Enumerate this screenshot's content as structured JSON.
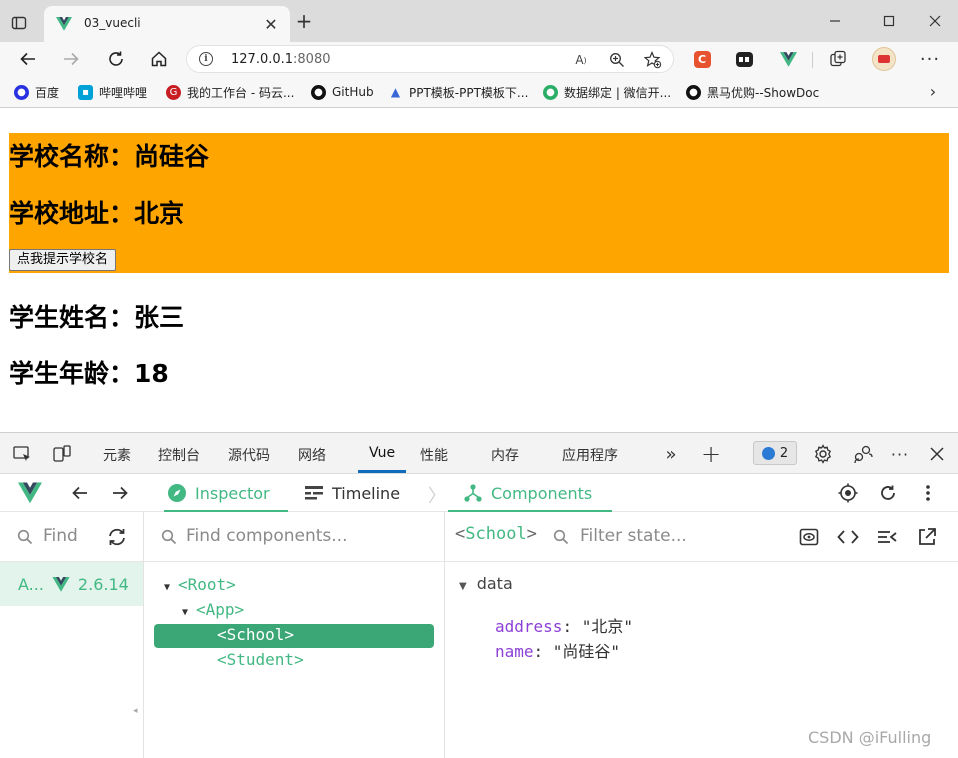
{
  "browser": {
    "tab_title": "03_vuecli",
    "url_host": "127.0.0.1",
    "url_port": ":8080",
    "extension_c_letter": "C",
    "bookmarks": [
      {
        "label": "百度",
        "icon": "baidu-paw-icon",
        "color": "#2932e1"
      },
      {
        "label": "哔哩哔哩",
        "icon": "bilibili-tv-icon",
        "color": "#00a1d6"
      },
      {
        "label": "我的工作台 - 码云...",
        "icon": "gitee-icon",
        "color": "#c71d23"
      },
      {
        "label": "GitHub",
        "icon": "github-icon",
        "color": "#111111"
      },
      {
        "label": "PPT模板-PPT模板下...",
        "icon": "ppt-icon",
        "color": "#3a66d6"
      },
      {
        "label": "数据绑定 | 微信开...",
        "icon": "wechat-icon",
        "color": "#2aae67"
      },
      {
        "label": "黑马优购--ShowDoc",
        "icon": "showdoc-icon",
        "color": "#111111"
      }
    ]
  },
  "page": {
    "school_name_label": "学校名称：尚硅谷",
    "school_address_label": "学校地址：北京",
    "show_name_button": "点我提示学校名",
    "student_name_label": "学生姓名：张三",
    "student_age_label": "学生年龄：18",
    "school_bg_color": "#ffa500"
  },
  "devtools": {
    "tabs": [
      "元素",
      "控制台",
      "源代码",
      "网络",
      "Vue",
      "性能",
      "内存",
      "应用程序"
    ],
    "active_tab": "Vue",
    "issues_count": "2",
    "vue": {
      "inspector_label": "Inspector",
      "timeline_label": "Timeline",
      "components_label": "Components",
      "find_placeholder": "Find",
      "find_components_placeholder": "Find components...",
      "filter_state_placeholder": "Filter state...",
      "app_name": "A...",
      "vue_version": "2.6.14",
      "tree": [
        {
          "tag": "<Root>",
          "depth": 0,
          "caret": true,
          "selected": false
        },
        {
          "tag": "<App>",
          "depth": 1,
          "caret": true,
          "selected": false
        },
        {
          "tag": "<School>",
          "depth": 2,
          "caret": false,
          "selected": true
        },
        {
          "tag": "<Student>",
          "depth": 2,
          "caret": false,
          "selected": false
        }
      ],
      "selected_component": "School",
      "data_section": "data",
      "state": [
        {
          "key": "address",
          "value": "\"北京\""
        },
        {
          "key": "name",
          "value": "\"尚硅谷\""
        }
      ],
      "accent_color": "#42b883"
    }
  },
  "watermark": "CSDN @iFulling"
}
